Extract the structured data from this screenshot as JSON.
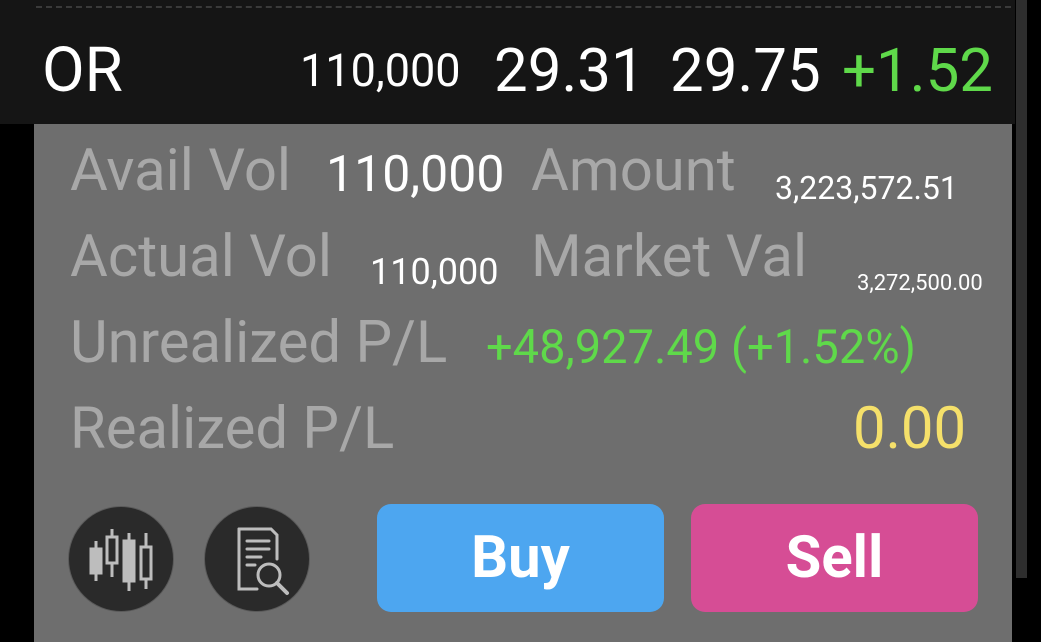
{
  "position": {
    "symbol": "OR",
    "volume": "110,000",
    "avg_cost": "29.31",
    "last_price": "29.75",
    "change": "+1.52"
  },
  "details": {
    "avail_vol_label": "Avail Vol",
    "avail_vol_value": "110,000",
    "amount_label": "Amount",
    "amount_value": "3,223,572.51",
    "actual_vol_label": "Actual Vol",
    "actual_vol_value": "110,000",
    "market_val_label": "Market Val",
    "market_val_value": "3,272,500.00",
    "unrealized_label": "Unrealized P/L",
    "unrealized_value": "+48,927.49 (+1.52%)",
    "realized_label": "Realized P/L",
    "realized_value": "0.00"
  },
  "actions": {
    "buy_label": "Buy",
    "sell_label": "Sell",
    "chart_icon": "candlestick-chart-icon",
    "report_icon": "document-search-icon"
  },
  "colors": {
    "gain": "#5fd94a",
    "realized": "#f5e06a",
    "buy": "#4da6f0",
    "sell": "#d64d95"
  }
}
